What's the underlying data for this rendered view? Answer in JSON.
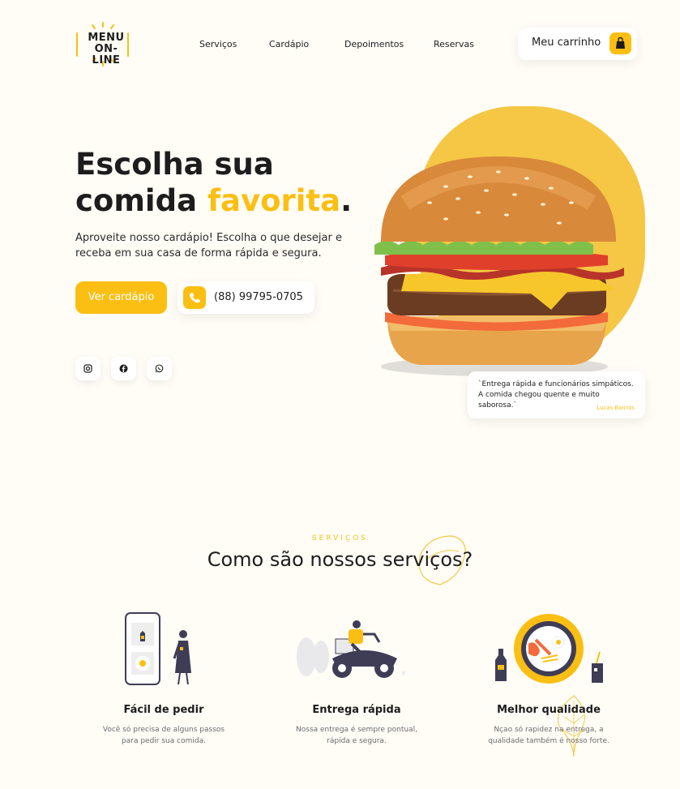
{
  "logo": {
    "line1": "MENU",
    "line2": "ON-LINE"
  },
  "nav": [
    {
      "label": "Serviços"
    },
    {
      "label": "Cardápio"
    },
    {
      "label": "Depoimentos"
    },
    {
      "label": "Reservas"
    }
  ],
  "cart": {
    "label": "Meu carrinho",
    "icon": "bag-icon"
  },
  "hero": {
    "title_line1": "Escolha sua",
    "title_line2_a": "comida ",
    "title_line2_accent": "favorita",
    "title_line2_end": ".",
    "description": "Aproveite nosso cardápio! Escolha o que desejar e receba em sua casa de forma rápida e segura.",
    "cta_label": "Ver cardápio",
    "phone": "(88) 99795-0705"
  },
  "social": [
    {
      "icon": "instagram-icon"
    },
    {
      "icon": "facebook-icon"
    },
    {
      "icon": "whatsapp-icon"
    }
  ],
  "review": {
    "quote": "`Entrega rápida e funcionários simpáticos. A comida chegou quente e muito saborosa.`",
    "author": "Lucas Bairros"
  },
  "services": {
    "subtitle": "SERVIÇOS",
    "title": "Como são nossos serviços?",
    "items": [
      {
        "title": "Fácil de pedir",
        "desc_line1": "Você só precisa de alguns passos",
        "desc_line2": "para pedir sua comida."
      },
      {
        "title": "Entrega rápida",
        "desc_line1": "Nossa entrega é sempre pontual,",
        "desc_line2": "rápida e segura."
      },
      {
        "title": "Melhor qualidade",
        "desc_line1": "Nçao só rapidez na entrega, a",
        "desc_line2": "qualidade também é nosso forte."
      }
    ]
  },
  "colors": {
    "accent": "#fbbf14",
    "background": "#fffdf6",
    "text": "#1d1d1d"
  }
}
